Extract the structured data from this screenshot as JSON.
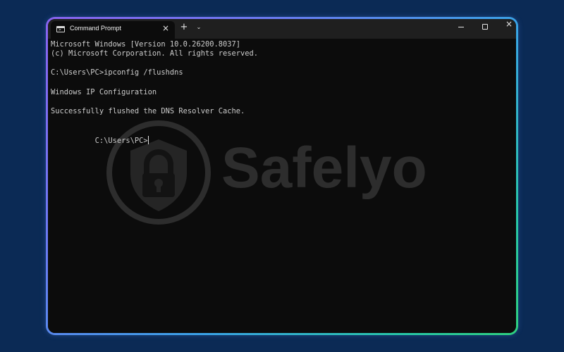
{
  "tab": {
    "title": "Command Prompt",
    "icon": "terminal-icon"
  },
  "terminal": {
    "lines": [
      "Microsoft Windows [Version 10.0.26200.8037]",
      "(c) Microsoft Corporation. All rights reserved.",
      "C:\\Users\\PC>ipconfig /flushdns",
      "Windows IP Configuration",
      "Successfully flushed the DNS Resolver Cache.",
      "C:\\Users\\PC>"
    ]
  },
  "watermark": {
    "text": "Safelyo",
    "icon": "shield-lock-icon"
  },
  "colors": {
    "background": "#0b2a55",
    "terminal_bg": "#0c0c0c",
    "titlebar_bg": "#1f1f1f",
    "terminal_text": "#cccccc",
    "frame_gradient_start": "#8a63f0",
    "frame_gradient_end": "#2fd07f"
  }
}
